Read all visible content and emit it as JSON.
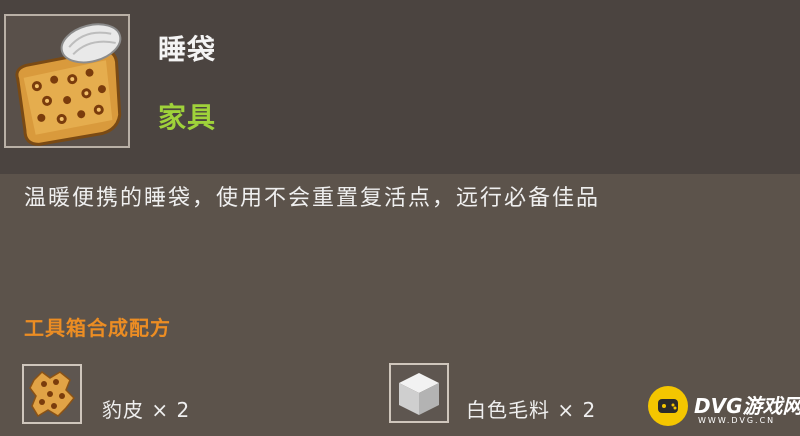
{
  "item": {
    "name": "睡袋",
    "category": "家具",
    "icon": "sleeping-bag-icon"
  },
  "description": "温暖便携的睡袋，使用不会重置复活点，远行必备佳品",
  "recipe": {
    "title": "工具箱合成配方",
    "materials": [
      {
        "label": "豹皮 × 2",
        "icon": "leopard-skin-icon"
      },
      {
        "label": "白色毛料 × 2",
        "icon": "white-wool-icon"
      }
    ]
  },
  "watermark": {
    "text": "DVG游戏网",
    "subtext": "WWW.DVG.CN",
    "color": "#f4c600"
  },
  "colors": {
    "item_name": "#f4f4f4",
    "category": "#9fd23a",
    "recipe_title": "#ec8d23",
    "background_top": "#4b4440",
    "background_bottom": "#5c534b"
  }
}
